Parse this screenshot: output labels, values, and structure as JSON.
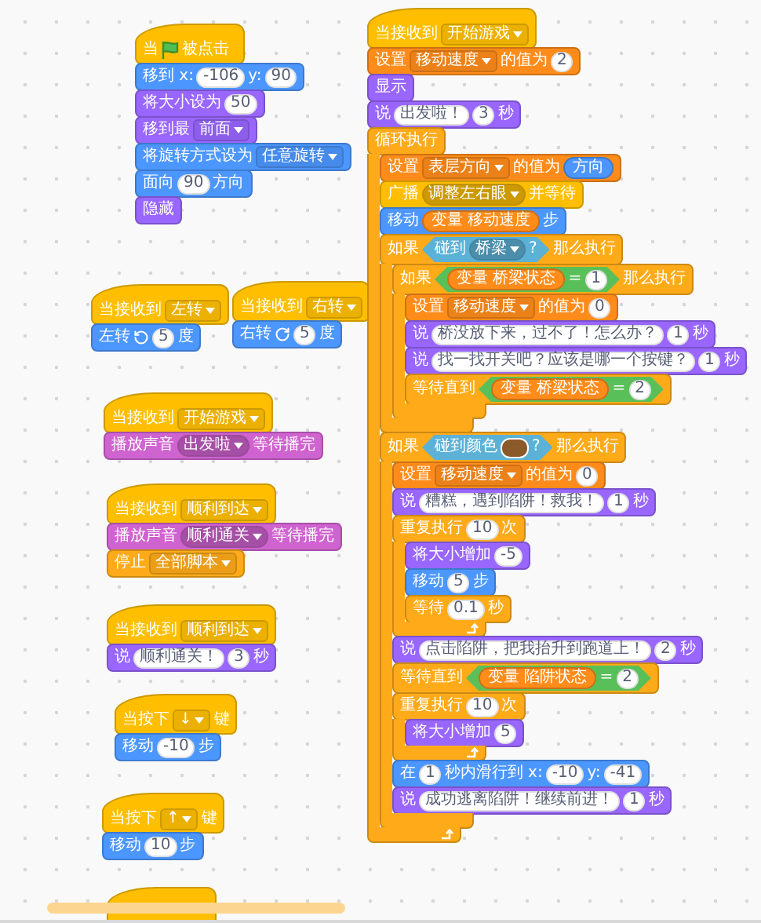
{
  "scripts": [
    {
      "blocks": [
        {
          "kind": "hat",
          "color": "#ffbf00",
          "parts": [
            {
              "kind": "label",
              "text": "当"
            },
            {
              "kind": "flag"
            },
            {
              "kind": "label",
              "text": "被点击"
            }
          ]
        },
        {
          "kind": "stack",
          "color": "#4c97ff",
          "parts": [
            {
              "kind": "label",
              "text": "移到 x:"
            },
            {
              "kind": "number",
              "text": "-106"
            },
            {
              "kind": "label",
              "text": "y:"
            },
            {
              "kind": "number",
              "text": "90"
            }
          ]
        },
        {
          "kind": "stack",
          "color": "#9966ff",
          "parts": [
            {
              "kind": "label",
              "text": "将大小设为"
            },
            {
              "kind": "number",
              "text": "50"
            }
          ]
        },
        {
          "kind": "stack",
          "color": "#9966ff",
          "parts": [
            {
              "kind": "label",
              "text": "移到最"
            },
            {
              "kind": "menu",
              "text": "前面"
            }
          ]
        },
        {
          "kind": "stack",
          "color": "#4c97ff",
          "parts": [
            {
              "kind": "label",
              "text": "将旋转方式设为"
            },
            {
              "kind": "menu",
              "text": "任意旋转"
            }
          ]
        },
        {
          "kind": "stack",
          "color": "#4c97ff",
          "parts": [
            {
              "kind": "label",
              "text": "面向"
            },
            {
              "kind": "number",
              "text": "90"
            },
            {
              "kind": "label",
              "text": "方向"
            }
          ]
        },
        {
          "kind": "stack",
          "color": "#9966ff",
          "parts": [
            {
              "kind": "label",
              "text": "隐藏"
            }
          ]
        }
      ]
    },
    {
      "blocks": [
        {
          "kind": "hat",
          "color": "#ffbf00",
          "parts": [
            {
              "kind": "label",
              "text": "当接收到"
            },
            {
              "kind": "menu",
              "text": "左转"
            }
          ]
        },
        {
          "kind": "stack",
          "color": "#4c97ff",
          "parts": [
            {
              "kind": "label",
              "text": "左转"
            },
            {
              "kind": "turn_left"
            },
            {
              "kind": "number",
              "text": "5"
            },
            {
              "kind": "label",
              "text": "度"
            }
          ]
        }
      ]
    },
    {
      "blocks": [
        {
          "kind": "hat",
          "color": "#ffbf00",
          "parts": [
            {
              "kind": "label",
              "text": "当接收到"
            },
            {
              "kind": "menu",
              "text": "右转"
            }
          ]
        },
        {
          "kind": "stack",
          "color": "#4c97ff",
          "parts": [
            {
              "kind": "label",
              "text": "右转"
            },
            {
              "kind": "turn_right"
            },
            {
              "kind": "number",
              "text": "5"
            },
            {
              "kind": "label",
              "text": "度"
            }
          ]
        }
      ]
    },
    {
      "blocks": [
        {
          "kind": "hat",
          "color": "#ffbf00",
          "parts": [
            {
              "kind": "label",
              "text": "当接收到"
            },
            {
              "kind": "menu",
              "text": "开始游戏"
            }
          ]
        },
        {
          "kind": "stack",
          "color": "#cf63cf",
          "parts": [
            {
              "kind": "label",
              "text": "播放声音"
            },
            {
              "kind": "round_menu",
              "text": "出发啦"
            },
            {
              "kind": "label",
              "text": "等待播完"
            }
          ]
        }
      ]
    },
    {
      "blocks": [
        {
          "kind": "hat",
          "color": "#ffbf00",
          "parts": [
            {
              "kind": "label",
              "text": "当接收到"
            },
            {
              "kind": "menu",
              "text": "顺利到达"
            }
          ]
        },
        {
          "kind": "stack",
          "color": "#cf63cf",
          "parts": [
            {
              "kind": "label",
              "text": "播放声音"
            },
            {
              "kind": "round_menu",
              "text": "顺利通关"
            },
            {
              "kind": "label",
              "text": "等待播完"
            }
          ]
        },
        {
          "kind": "cap",
          "color": "#ffab19",
          "parts": [
            {
              "kind": "label",
              "text": "停止"
            },
            {
              "kind": "menu",
              "text": "全部脚本"
            }
          ]
        }
      ]
    },
    {
      "blocks": [
        {
          "kind": "hat",
          "color": "#ffbf00",
          "parts": [
            {
              "kind": "label",
              "text": "当接收到"
            },
            {
              "kind": "menu",
              "text": "顺利到达"
            }
          ]
        },
        {
          "kind": "stack",
          "color": "#9966ff",
          "parts": [
            {
              "kind": "label",
              "text": "说"
            },
            {
              "kind": "string",
              "text": "顺利通关！"
            },
            {
              "kind": "number",
              "text": "3"
            },
            {
              "kind": "label",
              "text": "秒"
            }
          ]
        }
      ]
    },
    {
      "blocks": [
        {
          "kind": "hat",
          "color": "#ffbf00",
          "parts": [
            {
              "kind": "label",
              "text": "当按下"
            },
            {
              "kind": "menu",
              "text": "↓"
            },
            {
              "kind": "label",
              "text": "键"
            }
          ]
        },
        {
          "kind": "stack",
          "color": "#4c97ff",
          "parts": [
            {
              "kind": "label",
              "text": "移动"
            },
            {
              "kind": "number",
              "text": "-10"
            },
            {
              "kind": "label",
              "text": "步"
            }
          ]
        }
      ]
    },
    {
      "blocks": [
        {
          "kind": "hat",
          "color": "#ffbf00",
          "parts": [
            {
              "kind": "label",
              "text": "当按下"
            },
            {
              "kind": "menu",
              "text": "↑"
            },
            {
              "kind": "label",
              "text": "键"
            }
          ]
        },
        {
          "kind": "stack",
          "color": "#4c97ff",
          "parts": [
            {
              "kind": "label",
              "text": "移动"
            },
            {
              "kind": "number",
              "text": "10"
            },
            {
              "kind": "label",
              "text": "步"
            }
          ]
        }
      ]
    },
    {
      "blocks": [
        {
          "kind": "hat",
          "color": "#ffbf00"
        }
      ]
    },
    {
      "blocks": [
        {
          "kind": "hat",
          "color": "#ffbf00",
          "parts": [
            {
              "kind": "label",
              "text": "当接收到"
            },
            {
              "kind": "menu",
              "text": "开始游戏"
            }
          ]
        },
        {
          "kind": "stack",
          "color": "#ff8c1a",
          "parts": [
            {
              "kind": "label",
              "text": "设置"
            },
            {
              "kind": "menu",
              "text": "移动速度"
            },
            {
              "kind": "label",
              "text": "的值为"
            },
            {
              "kind": "number",
              "text": "2"
            }
          ]
        },
        {
          "kind": "stack",
          "color": "#9966ff",
          "parts": [
            {
              "kind": "label",
              "text": "显示"
            }
          ]
        },
        {
          "kind": "stack",
          "color": "#9966ff",
          "parts": [
            {
              "kind": "label",
              "text": "说"
            },
            {
              "kind": "string",
              "text": "出发啦！"
            },
            {
              "kind": "number",
              "text": "3"
            },
            {
              "kind": "label",
              "text": "秒"
            }
          ]
        },
        {
          "kind": "forever",
          "color": "#ffab19",
          "parts": [
            {
              "kind": "label",
              "text": "循环执行"
            }
          ],
          "children": [
            {
              "kind": "stack",
              "color": "#ff8c1a",
              "parts": [
                {
                  "kind": "label",
                  "text": "设置"
                },
                {
                  "kind": "menu",
                  "text": "表层方向"
                },
                {
                  "kind": "label",
                  "text": "的值为"
                },
                {
                  "kind": "reporter",
                  "color": "#4c97ff",
                  "text": "方向"
                }
              ]
            },
            {
              "kind": "stack",
              "color": "#ffbf00",
              "parts": [
                {
                  "kind": "label",
                  "text": "广播"
                },
                {
                  "kind": "round_menu",
                  "text": "调整左右眼"
                },
                {
                  "kind": "label",
                  "text": "并等待"
                }
              ]
            },
            {
              "kind": "stack",
              "color": "#4c97ff",
              "parts": [
                {
                  "kind": "label",
                  "text": "移动"
                },
                {
                  "kind": "reporter",
                  "color": "#ff8c1a",
                  "text": "变量 移动速度"
                },
                {
                  "kind": "label",
                  "text": "步"
                }
              ]
            },
            {
              "kind": "if",
              "color": "#ffab19",
              "parts": [
                {
                  "kind": "label",
                  "text": "如果"
                },
                {
                  "kind": "boolean",
                  "color": "#5cb1d6",
                  "parts": [
                    {
                      "kind": "label",
                      "text": "碰到"
                    },
                    {
                      "kind": "round_menu",
                      "text": "桥梁"
                    },
                    {
                      "kind": "label",
                      "text": "?"
                    }
                  ]
                },
                {
                  "kind": "label",
                  "text": "那么执行"
                }
              ],
              "children": [
                {
                  "kind": "if",
                  "color": "#ffab19",
                  "parts": [
                    {
                      "kind": "label",
                      "text": "如果"
                    },
                    {
                      "kind": "boolean",
                      "color": "#59c059",
                      "parts": [
                        {
                          "kind": "reporter",
                          "color": "#ff8c1a",
                          "text": "变量 桥梁状态"
                        },
                        {
                          "kind": "label",
                          "text": "="
                        },
                        {
                          "kind": "number",
                          "text": "1"
                        }
                      ]
                    },
                    {
                      "kind": "label",
                      "text": "那么执行"
                    }
                  ],
                  "children": [
                    {
                      "kind": "stack",
                      "color": "#ff8c1a",
                      "parts": [
                        {
                          "kind": "label",
                          "text": "设置"
                        },
                        {
                          "kind": "menu",
                          "text": "移动速度"
                        },
                        {
                          "kind": "label",
                          "text": "的值为"
                        },
                        {
                          "kind": "number",
                          "text": "0"
                        }
                      ]
                    },
                    {
                      "kind": "stack",
                      "color": "#9966ff",
                      "parts": [
                        {
                          "kind": "label",
                          "text": "说"
                        },
                        {
                          "kind": "string",
                          "text": "桥没放下来，过不了！怎么办？"
                        },
                        {
                          "kind": "number",
                          "text": "1"
                        },
                        {
                          "kind": "label",
                          "text": "秒"
                        }
                      ]
                    },
                    {
                      "kind": "stack",
                      "color": "#9966ff",
                      "parts": [
                        {
                          "kind": "label",
                          "text": "说"
                        },
                        {
                          "kind": "string",
                          "text": "找一找开关吧？应该是哪一个按键？"
                        },
                        {
                          "kind": "number",
                          "text": "1"
                        },
                        {
                          "kind": "label",
                          "text": "秒"
                        }
                      ]
                    },
                    {
                      "kind": "stack",
                      "color": "#ffab19",
                      "parts": [
                        {
                          "kind": "label",
                          "text": "等待直到"
                        },
                        {
                          "kind": "boolean",
                          "color": "#59c059",
                          "parts": [
                            {
                              "kind": "reporter",
                              "color": "#ff8c1a",
                              "text": "变量 桥梁状态"
                            },
                            {
                              "kind": "label",
                              "text": "="
                            },
                            {
                              "kind": "number",
                              "text": "2"
                            }
                          ]
                        }
                      ]
                    }
                  ]
                }
              ]
            },
            {
              "kind": "if",
              "color": "#ffab19",
              "parts": [
                {
                  "kind": "label",
                  "text": "如果"
                },
                {
                  "kind": "boolean",
                  "color": "#5cb1d6",
                  "parts": [
                    {
                      "kind": "label",
                      "text": "碰到颜色"
                    },
                    {
                      "kind": "swatch",
                      "color": "#8b5a2b"
                    },
                    {
                      "kind": "label",
                      "text": "?"
                    }
                  ]
                },
                {
                  "kind": "label",
                  "text": "那么执行"
                }
              ],
              "children": [
                {
                  "kind": "stack",
                  "color": "#ff8c1a",
                  "parts": [
                    {
                      "kind": "label",
                      "text": "设置"
                    },
                    {
                      "kind": "menu",
                      "text": "移动速度"
                    },
                    {
                      "kind": "label",
                      "text": "的值为"
                    },
                    {
                      "kind": "number",
                      "text": "0"
                    }
                  ]
                },
                {
                  "kind": "stack",
                  "color": "#9966ff",
                  "parts": [
                    {
                      "kind": "label",
                      "text": "说"
                    },
                    {
                      "kind": "string",
                      "text": "糟糕，遇到陷阱！救我！"
                    },
                    {
                      "kind": "number",
                      "text": "1"
                    },
                    {
                      "kind": "label",
                      "text": "秒"
                    }
                  ]
                },
                {
                  "kind": "repeat",
                  "color": "#ffab19",
                  "parts": [
                    {
                      "kind": "label",
                      "text": "重复执行"
                    },
                    {
                      "kind": "number",
                      "text": "10"
                    },
                    {
                      "kind": "label",
                      "text": "次"
                    }
                  ],
                  "children": [
                    {
                      "kind": "stack",
                      "color": "#9966ff",
                      "parts": [
                        {
                          "kind": "label",
                          "text": "将大小增加"
                        },
                        {
                          "kind": "number",
                          "text": "-5"
                        }
                      ]
                    },
                    {
                      "kind": "stack",
                      "color": "#4c97ff",
                      "parts": [
                        {
                          "kind": "label",
                          "text": "移动"
                        },
                        {
                          "kind": "number",
                          "text": "5"
                        },
                        {
                          "kind": "label",
                          "text": "步"
                        }
                      ]
                    },
                    {
                      "kind": "stack",
                      "color": "#ffab19",
                      "parts": [
                        {
                          "kind": "label",
                          "text": "等待"
                        },
                        {
                          "kind": "number",
                          "text": "0.1"
                        },
                        {
                          "kind": "label",
                          "text": "秒"
                        }
                      ]
                    }
                  ]
                },
                {
                  "kind": "stack",
                  "color": "#9966ff",
                  "parts": [
                    {
                      "kind": "label",
                      "text": "说"
                    },
                    {
                      "kind": "string",
                      "text": "点击陷阱，把我抬升到跑道上！"
                    },
                    {
                      "kind": "number",
                      "text": "2"
                    },
                    {
                      "kind": "label",
                      "text": "秒"
                    }
                  ]
                },
                {
                  "kind": "stack",
                  "color": "#ffab19",
                  "parts": [
                    {
                      "kind": "label",
                      "text": "等待直到"
                    },
                    {
                      "kind": "boolean",
                      "color": "#59c059",
                      "parts": [
                        {
                          "kind": "reporter",
                          "color": "#ff8c1a",
                          "text": "变量 陷阱状态"
                        },
                        {
                          "kind": "label",
                          "text": "="
                        },
                        {
                          "kind": "number",
                          "text": "2"
                        }
                      ]
                    }
                  ]
                },
                {
                  "kind": "repeat",
                  "color": "#ffab19",
                  "parts": [
                    {
                      "kind": "label",
                      "text": "重复执行"
                    },
                    {
                      "kind": "number",
                      "text": "10"
                    },
                    {
                      "kind": "label",
                      "text": "次"
                    }
                  ],
                  "children": [
                    {
                      "kind": "stack",
                      "color": "#9966ff",
                      "parts": [
                        {
                          "kind": "label",
                          "text": "将大小增加"
                        },
                        {
                          "kind": "number",
                          "text": "5"
                        }
                      ]
                    }
                  ]
                },
                {
                  "kind": "stack",
                  "color": "#4c97ff",
                  "parts": [
                    {
                      "kind": "label",
                      "text": "在"
                    },
                    {
                      "kind": "number",
                      "text": "1"
                    },
                    {
                      "kind": "label",
                      "text": "秒内滑行到 x:"
                    },
                    {
                      "kind": "number",
                      "text": "-10"
                    },
                    {
                      "kind": "label",
                      "text": "y:"
                    },
                    {
                      "kind": "number",
                      "text": "-41"
                    }
                  ]
                },
                {
                  "kind": "stack",
                  "color": "#9966ff",
                  "parts": [
                    {
                      "kind": "label",
                      "text": "说"
                    },
                    {
                      "kind": "string",
                      "text": "成功逃离陷阱！继续前进！"
                    },
                    {
                      "kind": "number",
                      "text": "1"
                    },
                    {
                      "kind": "label",
                      "text": "秒"
                    }
                  ]
                }
              ]
            }
          ]
        }
      ]
    }
  ]
}
